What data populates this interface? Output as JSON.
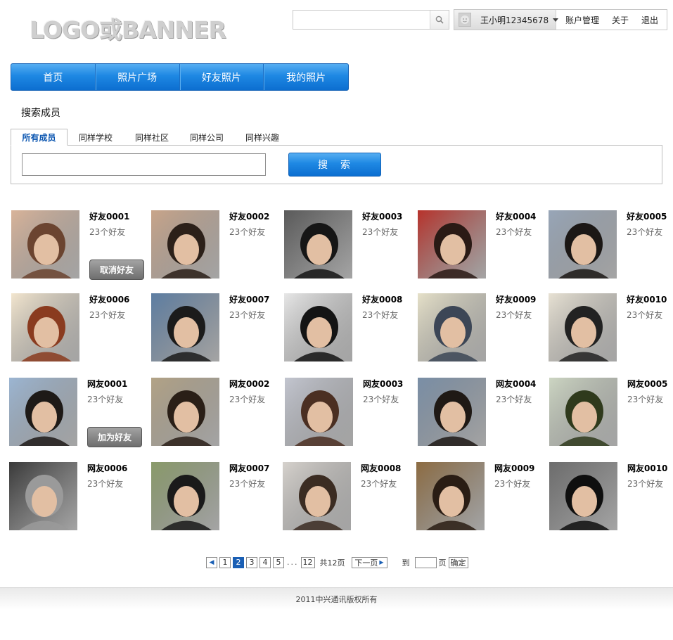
{
  "logo": {
    "text": "LOGO或BANNER"
  },
  "topsearch": {
    "placeholder": ""
  },
  "userbar": {
    "username": "王小明12345678",
    "links": [
      "账户管理",
      "关于",
      "退出"
    ]
  },
  "nav": {
    "items": [
      "首页",
      "照片广场",
      "好友照片",
      "我的照片"
    ]
  },
  "search_section": {
    "title": "搜索成员",
    "tabs": [
      "所有成员",
      "同样学校",
      "同样社区",
      "同样公司",
      "同样兴趣"
    ],
    "input_value": "",
    "button": "搜　索"
  },
  "members": [
    {
      "name": "好友0001",
      "count": "23个好友",
      "action": "取消好友",
      "bg": "#d9b49a",
      "hair": "#6b4430"
    },
    {
      "name": "好友0002",
      "count": "23个好友",
      "bg": "#c9a58a",
      "hair": "#2c2019"
    },
    {
      "name": "好友0003",
      "count": "23个好友",
      "bg": "#5a5a5a",
      "hair": "#161616"
    },
    {
      "name": "好友0004",
      "count": "23个好友",
      "bg": "#b8322b",
      "hair": "#2a1a15"
    },
    {
      "name": "好友0005",
      "count": "23个好友",
      "bg": "#98a6b8",
      "hair": "#1b1715"
    },
    {
      "name": "好友0006",
      "count": "23个好友",
      "bg": "#f3e6cf",
      "hair": "#8a3b1f"
    },
    {
      "name": "好友0007",
      "count": "23个好友",
      "bg": "#5d7ea3",
      "hair": "#1b1b1b"
    },
    {
      "name": "好友0008",
      "count": "23个好友",
      "bg": "#e7e7e7",
      "hair": "#141414"
    },
    {
      "name": "好友0009",
      "count": "23个好友",
      "bg": "#e6e1c9",
      "hair": "#3c4656"
    },
    {
      "name": "好友0010",
      "count": "23个好友",
      "bg": "#e8e2d4",
      "hair": "#222222"
    },
    {
      "name": "网友0001",
      "count": "23个好友",
      "action": "加为好友",
      "bg": "#9cb6d3",
      "hair": "#1e1a17"
    },
    {
      "name": "网友0002",
      "count": "23个好友",
      "bg": "#b3a386",
      "hair": "#2a1f17"
    },
    {
      "name": "网友0003",
      "count": "23个好友",
      "bg": "#c3c6d0",
      "hair": "#4b2f22"
    },
    {
      "name": "网友0004",
      "count": "23个好友",
      "bg": "#7a8fa7",
      "hair": "#1f1915"
    },
    {
      "name": "网友0005",
      "count": "23个好友",
      "bg": "#cdd6c3",
      "hair": "#2f3a1c"
    },
    {
      "name": "网友0006",
      "count": "23个好友",
      "bg": "#3a3a3a",
      "hair": "#9a9a9a"
    },
    {
      "name": "网友0007",
      "count": "23个好友",
      "bg": "#8a9b6a",
      "hair": "#1a1a1a"
    },
    {
      "name": "网友0008",
      "count": "23个好友",
      "bg": "#d6d2cd",
      "hair": "#3b2c22"
    },
    {
      "name": "网友0009",
      "count": "23个好友",
      "bg": "#8d6c42",
      "hair": "#2a1d14"
    },
    {
      "name": "网友0010",
      "count": "23个好友",
      "bg": "#6d6d6d",
      "hair": "#0f0f0f"
    }
  ],
  "pager": {
    "prev_icon": "left-triangle-icon",
    "pages": [
      "1",
      "2",
      "3",
      "4",
      "5"
    ],
    "current": "2",
    "ellipsis": "...",
    "last": "12",
    "total": "共12页",
    "next": "下一页",
    "goto_label": "到",
    "page_unit": "页",
    "confirm": "确定"
  },
  "footer": {
    "text": "2011中兴通讯版权所有"
  },
  "colors": {
    "accent": "#1e88e3",
    "current_page": "#1a5fb4"
  }
}
